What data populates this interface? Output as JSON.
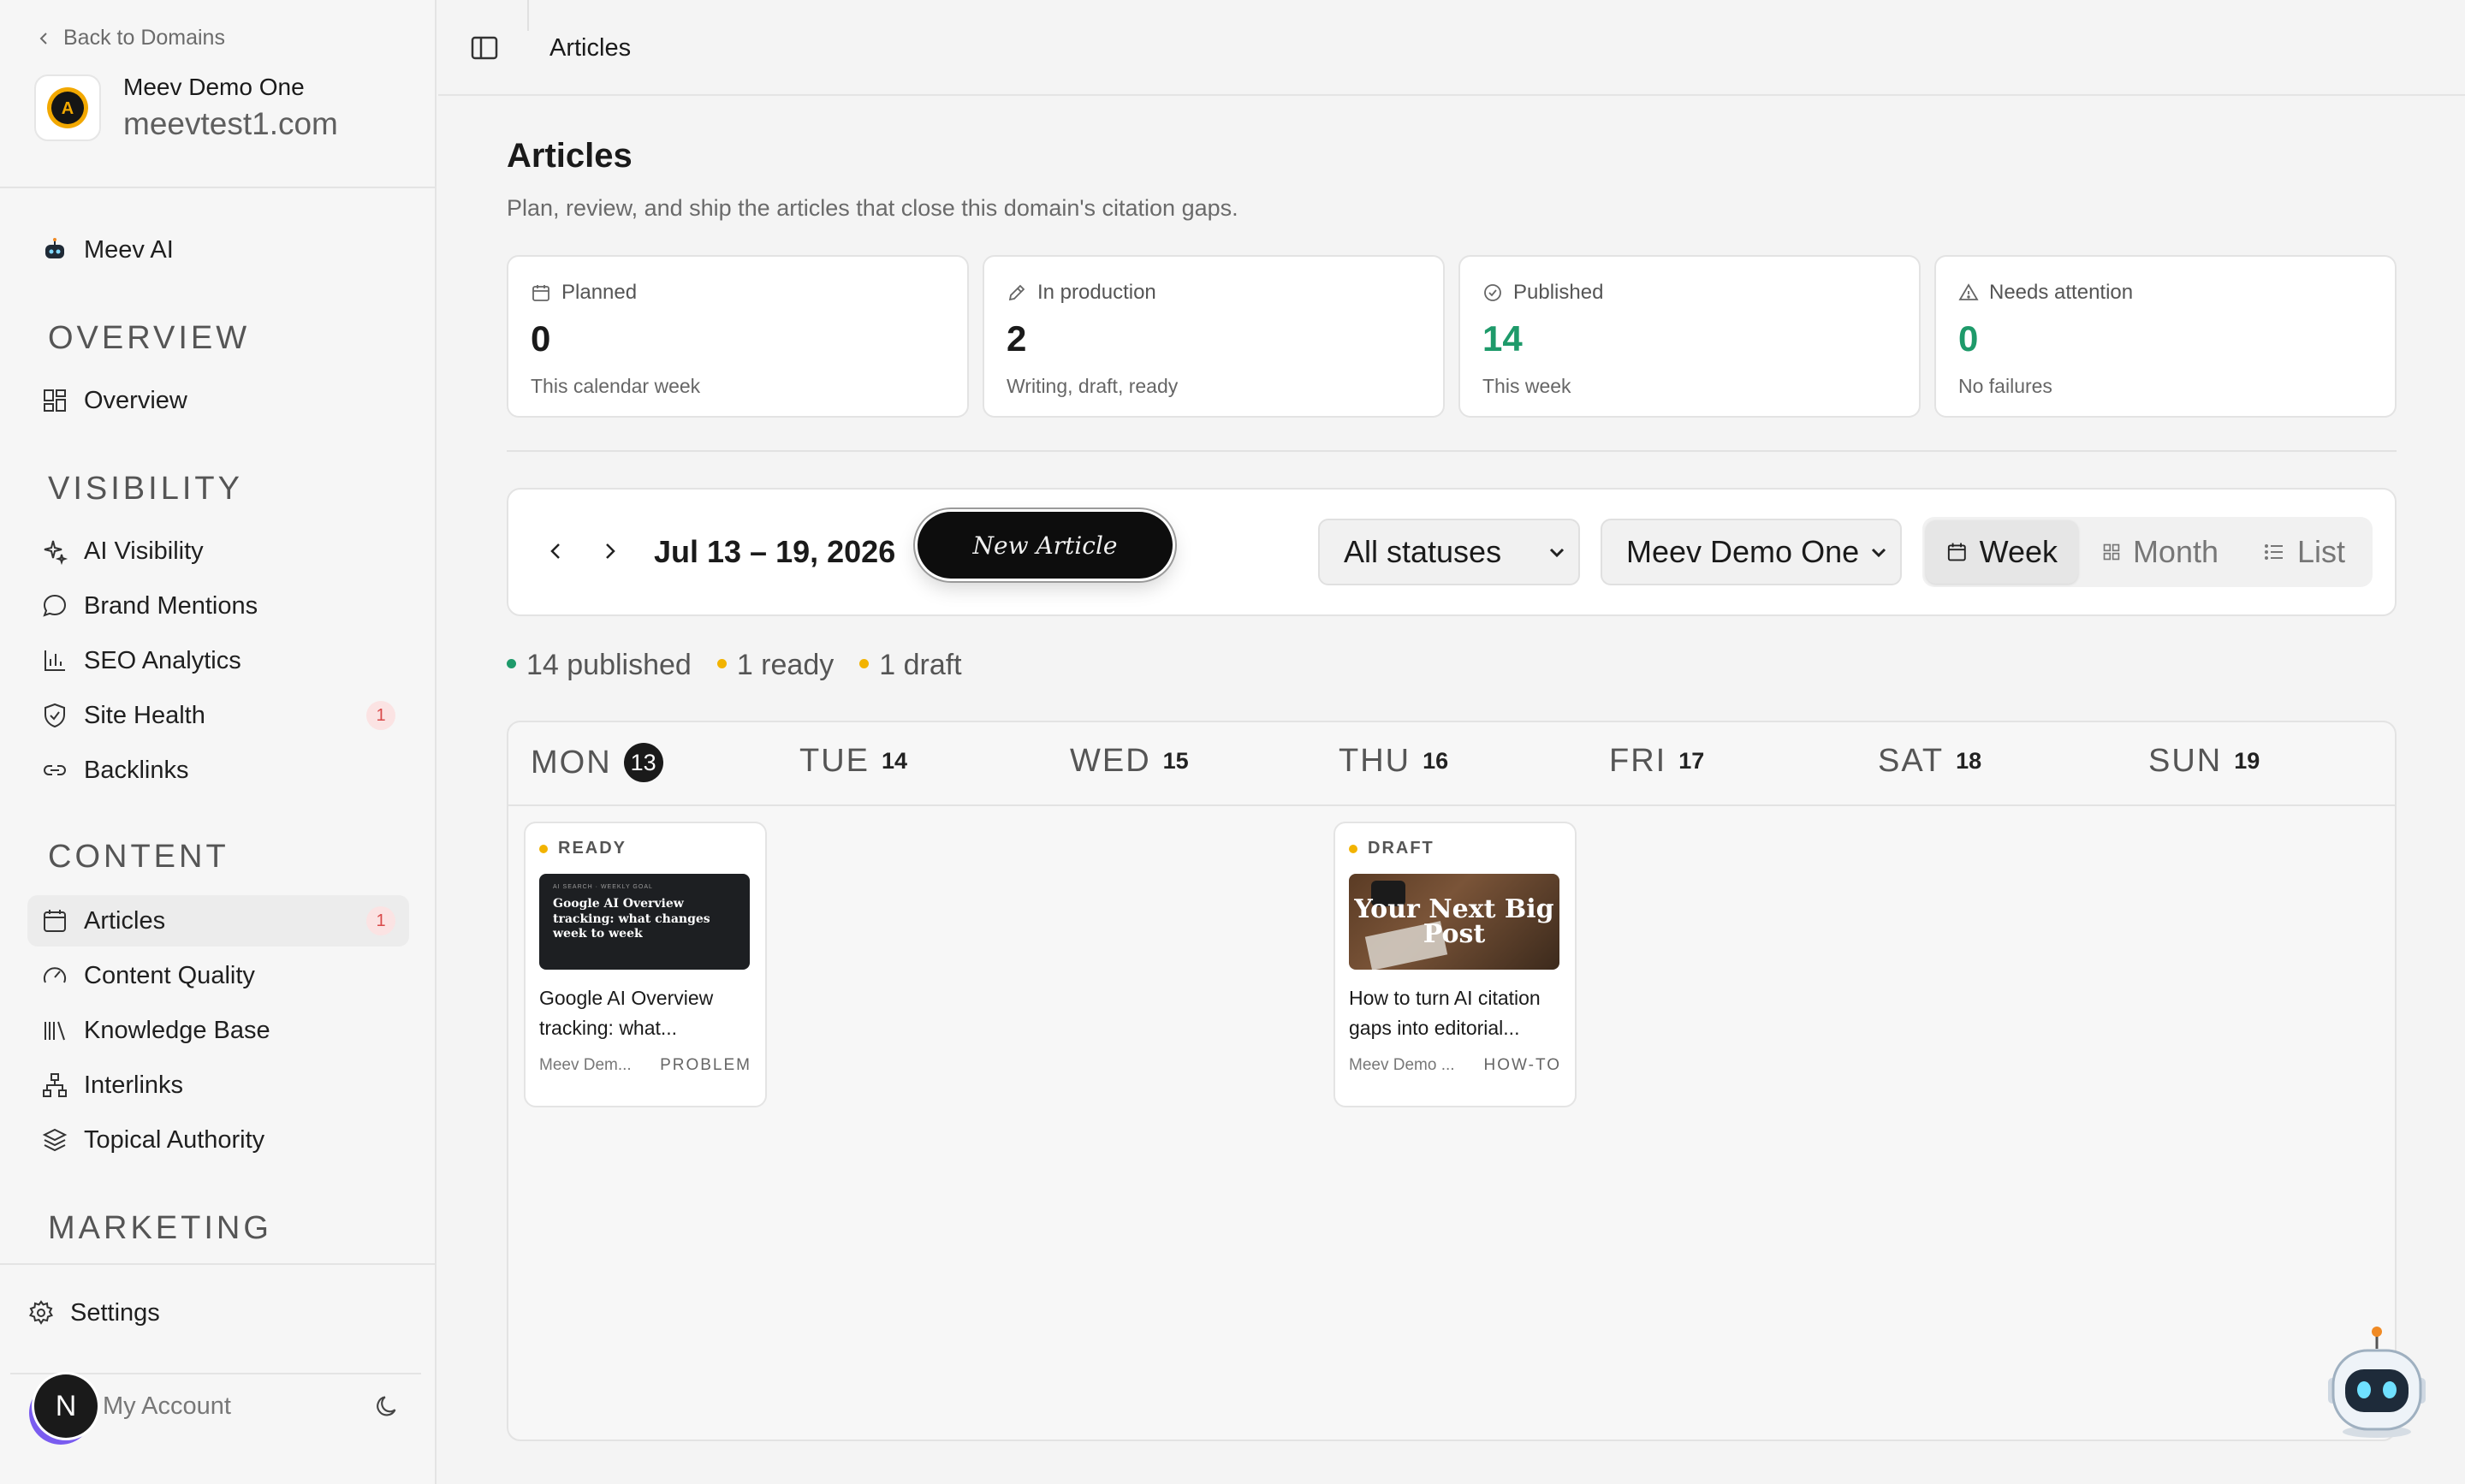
{
  "sidebar": {
    "back_label": "Back to Domains",
    "domain_name": "Meev Demo One",
    "domain_url": "meevtest1.com",
    "meev_ai": "Meev AI",
    "sections": {
      "overview": "OVERVIEW",
      "visibility": "VISIBILITY",
      "content": "CONTENT",
      "marketing": "MARKETING"
    },
    "items": {
      "overview": "Overview",
      "ai_visibility": "AI Visibility",
      "brand_mentions": "Brand Mentions",
      "seo_analytics": "SEO Analytics",
      "site_health": "Site Health",
      "site_health_badge": "1",
      "backlinks": "Backlinks",
      "articles": "Articles",
      "articles_badge": "1",
      "content_quality": "Content Quality",
      "knowledge_base": "Knowledge Base",
      "interlinks": "Interlinks",
      "topical_authority": "Topical Authority"
    },
    "settings": "Settings",
    "account_initial": "N",
    "account_label": "My Account"
  },
  "topbar": {
    "title": "Articles"
  },
  "page": {
    "title": "Articles",
    "subtitle": "Plan, review, and ship the articles that close this domain's citation gaps."
  },
  "stats": [
    {
      "label": "Planned",
      "value": "0",
      "note": "This calendar week",
      "icon": "calendar-icon"
    },
    {
      "label": "In production",
      "value": "2",
      "note": "Writing, draft, ready",
      "icon": "pencil-icon"
    },
    {
      "label": "Published",
      "value": "14",
      "note": "This week",
      "icon": "check-circle-icon",
      "color": "#1e9a6a"
    },
    {
      "label": "Needs attention",
      "value": "0",
      "note": "No failures",
      "icon": "warning-icon",
      "color": "#1e9a6a"
    }
  ],
  "toolbar": {
    "date_range": "Jul 13 – 19, 2026",
    "new_article": "New Article",
    "status_filter": "All statuses",
    "domain_filter": "Meev Demo One",
    "views": {
      "week": "Week",
      "month": "Month",
      "list": "List"
    },
    "active_view": "Week"
  },
  "legend": [
    {
      "label": "14 published",
      "color": "#1e9a6a"
    },
    {
      "label": "1 ready",
      "color": "#f2b300"
    },
    {
      "label": "1 draft",
      "color": "#f2b300"
    }
  ],
  "calendar": {
    "days": [
      {
        "name": "MON",
        "num": "13",
        "today": true
      },
      {
        "name": "TUE",
        "num": "14"
      },
      {
        "name": "WED",
        "num": "15"
      },
      {
        "name": "THU",
        "num": "16"
      },
      {
        "name": "FRI",
        "num": "17"
      },
      {
        "name": "SAT",
        "num": "18"
      },
      {
        "name": "SUN",
        "num": "19"
      }
    ],
    "articles": [
      {
        "status": "READY",
        "thumb_kicker": "AI SEARCH · WEEKLY GOAL",
        "thumb_title": "Google AI Overview tracking: what changes week to week",
        "title": "Google AI Overview tracking: what...",
        "domain": "Meev Dem...",
        "tag": "PROBLEM"
      },
      {
        "status": "DRAFT",
        "thumb_title": "Your Next Big Post",
        "title": "How to turn AI citation gaps into editorial...",
        "domain": "Meev Demo ...",
        "tag": "HOW-TO"
      }
    ]
  },
  "colors": {
    "accent_green": "#1e9a6a",
    "warn_yellow": "#f2b300",
    "badge_red": "#d94a4a"
  }
}
